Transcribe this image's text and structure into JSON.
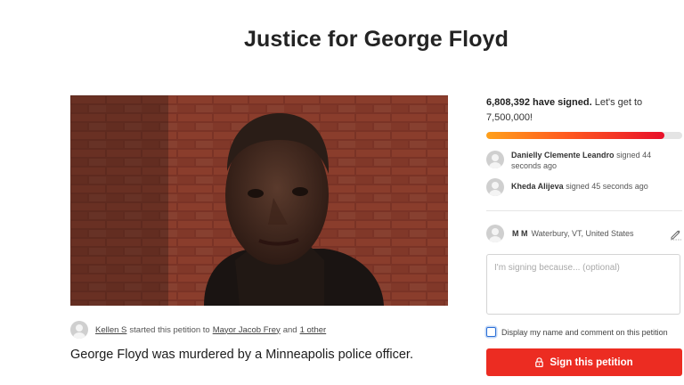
{
  "petition": {
    "title": "Justice for George Floyd",
    "description": "George Floyd was murdered by a Minneapolis police officer."
  },
  "starter": {
    "name": "Kellen S",
    "text_started": "started this petition to",
    "target": "Mayor Jacob Frey",
    "text_and": "and",
    "others": "1 other"
  },
  "signatures": {
    "count": "6,808,392 have signed.",
    "goal_text": "Let's get to 7,500,000!",
    "progress_fraction": 0.908,
    "recent": [
      {
        "name": "Danielly Clemente Leandro",
        "action": "signed 44 seconds ago"
      },
      {
        "name": "Kheda Alijeva",
        "action": "signed 45 seconds ago"
      }
    ]
  },
  "current_user": {
    "name": "M M",
    "location": "Waterbury, VT, United States"
  },
  "form": {
    "comment_placeholder": "I'm signing because... (optional)",
    "display_checkbox_label": "Display my name and comment on this petition",
    "sign_button_label": "Sign this petition"
  },
  "colors": {
    "button": "#ec2c22",
    "progress_start": "#ffa01a",
    "progress_end": "#e8102a",
    "checkbox": "#2b6fd6"
  },
  "icons": {
    "avatar": "user-avatar-icon",
    "edit": "pencil-icon",
    "sign": "lock-icon"
  }
}
